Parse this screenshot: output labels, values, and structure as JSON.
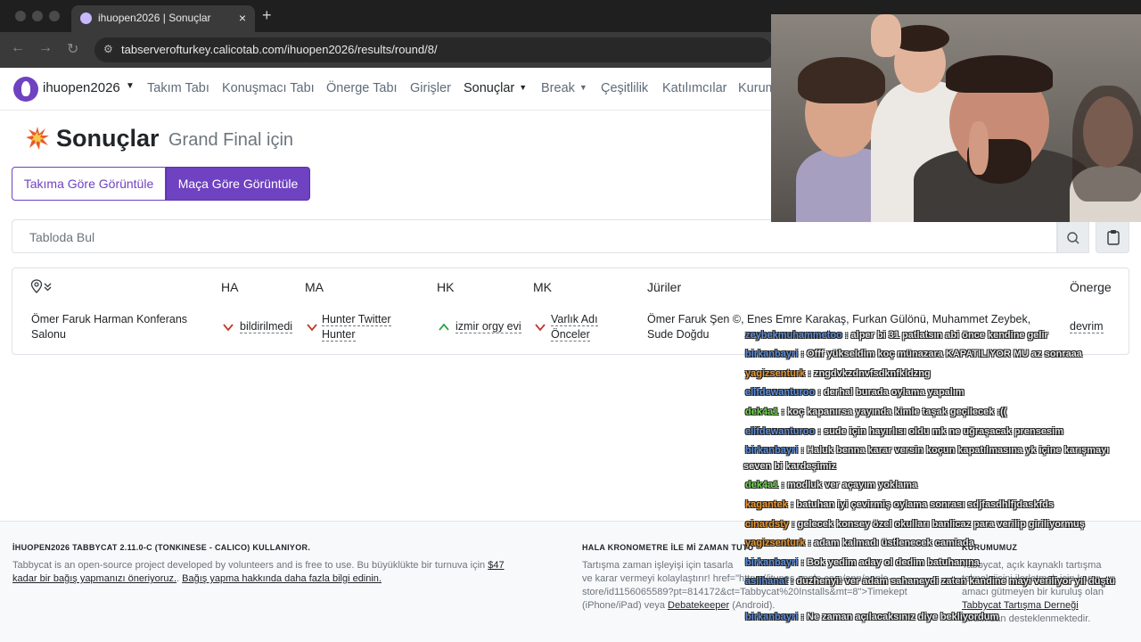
{
  "browser": {
    "tab_title": "ihuopen2026 | Sonuçlar",
    "close_glyph": "×",
    "new_tab_glyph": "+",
    "url": "tabserverofturkey.calicotab.com/ihuopen2026/results/round/8/"
  },
  "nav": {
    "brand": "ihuopen2026",
    "links": [
      "Takım Tabı",
      "Konuşmacı Tabı",
      "Önerge Tabı",
      "Girişler",
      "Sonuçlar",
      "Break",
      "Çeşitlilik",
      "Katılımcılar",
      "Kurum"
    ]
  },
  "page": {
    "title": "Sonuçlar",
    "subtitle": "Grand Final için",
    "btn_team": "Takıma Göre Görüntüle",
    "btn_match": "Maça Göre Görüntüle",
    "search_placeholder": "Tabloda Bul"
  },
  "table": {
    "headers": [
      "HA",
      "MA",
      "HK",
      "MK",
      "Jüriler",
      "Önerge"
    ],
    "row": {
      "venue_1": "Ömer Faruk Harman Konferans",
      "venue_2": "Salonu",
      "ha": "bildirilmedi",
      "ma_1": "Hunter Twitter",
      "ma_2": "Hunter",
      "hk": "izmir orgy evi",
      "mk_1": "Varlık Adı",
      "mk_2": "Önceler",
      "judges_1": "Ömer Faruk Şen ©, Enes Emre Karakaş, Furkan Gülönü, Muhammet Zeybek,",
      "judges_2": "Sude Doğdu",
      "motion": "devrim"
    },
    "status_colors": {
      "loss": "#c0392b",
      "win": "#28a745"
    }
  },
  "footer": {
    "col1_heading": "İHUOPEN2026 TABBYCAT 2.11.0-C (TONKINESE - CALICO) KULLANIYOR.",
    "col1_line1_a": "Tabbycat is an open-source project developed by volunteers and is free to use. Bu büyüklükte bir turnuva için",
    "col1_line1_link": "$47",
    "col1_line2_link": "kadar bir bağış yapmanızı öneriyoruz.",
    "col1_line2_b": ".",
    "col1_line2_link2": "Bağış yapma hakkında daha fazla bilgi edinin.",
    "col2_heading": "HALA KRONOMETRE İLE Mİ ZAMAN TUTU",
    "col2_line1": "Tartışma zaman işleyişi için tasarla",
    "col2_line2": "ve karar vermeyi kolaylaştırır! href=\"https://itunes.apple.com/app/apple-",
    "col2_line3": "store/id1156065589?pt=814172&ct=Tabbycat%20Installs&mt=8\">Timekept",
    "col2_line4_a": "(iPhone/iPad) veya",
    "col2_line4_link": "Debatekeeper",
    "col2_line4_b": "(Android).",
    "col3_heading": "KURUMUMUZ",
    "col3_line1": "Tabbycat, açık kaynaklı tartışma",
    "col3_line2": "teknolojisini ilerletmek için kar",
    "col3_line3": "amacı gütmeyen bir kuruluş olan",
    "col3_line4": "Tabbycat Tartışma Derneği",
    "col3_line5": "tarafından desteklenmektedir."
  },
  "chat": [
    {
      "user": "zeybekmuhammetoo",
      "text": ": alper bi 31 patlatsın abi önce kendine gelir",
      "color": "#5b8dd9"
    },
    {
      "user": "birkanbayri",
      "text": ": Offf yükseldim koç münazara KAPATILIYOR MU az sonraaa",
      "color": "#5b8dd9"
    },
    {
      "user": "yagizsenturk",
      "text": ": zngdvkzdnvfsdknfkldzng",
      "color": "#e8962e"
    },
    {
      "user": "elifdewanturoo",
      "text": ": derhal burada oylama yapalım",
      "color": "#5b8dd9"
    },
    {
      "user": "dek4a1",
      "text": ": koç kapanırsa yayında kimle taşak geçilecek :((",
      "color": "#6fd94a"
    },
    {
      "user": "elifdewanturoo",
      "text": ": sude için hayırlısı oldu mk ne uğraşacak prensesim",
      "color": "#5b8dd9"
    },
    {
      "user": "birkanbayri",
      "text": ": Haluk benna karar versin koçun kapatılmasına yk içine karışmayı",
      "color": "#5b8dd9"
    },
    {
      "user": "",
      "text": "seven bi kardeşimiz",
      "color": "#5b8dd9"
    },
    {
      "user": "dek4a1",
      "text": ": modluk ver açayım yoklama",
      "color": "#6fd94a"
    },
    {
      "user": "kagantek",
      "text": ": batuhan iyi çevirmiş oylama sonrası sdjfasdhlfjdaskfds",
      "color": "#e8962e"
    },
    {
      "user": "cinardsty",
      "text": ": gelecek konsey özel okulları banlicaz para verilip giriliyormuş",
      "color": "#e8962e"
    },
    {
      "user": "yagizsenturk",
      "text": ": adam kalmadı üstlenecek camiada",
      "color": "#e8962e"
    },
    {
      "user": "birkanbayri",
      "text": ": Bok yedim aday ol dedim batuhanına",
      "color": "#5b8dd9"
    },
    {
      "user": "aslihanat",
      "text": ": duzhenyi: ver adam sahaneydi zaten kandine mayı veriliyor yıl düştü",
      "color": "#5b8dd9"
    },
    {
      "user": "birkanbayri",
      "text": ": Ne zaman açılacaksınız diye bekliyordum",
      "color": "#5b8dd9"
    }
  ]
}
